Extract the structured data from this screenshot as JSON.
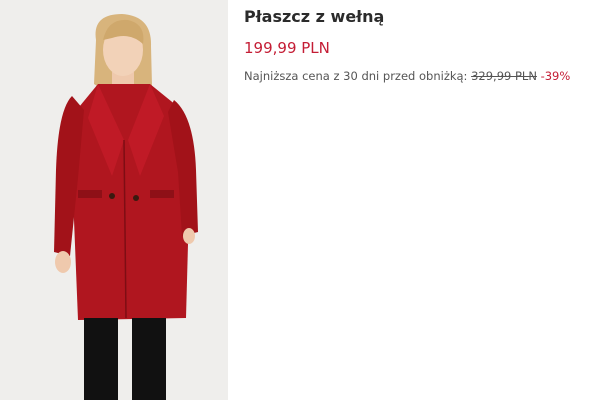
{
  "product": {
    "name": "Płaszcz z wełną",
    "price": "199,99 PLN",
    "lowest_price_label": "Najniższa cena z 30 dni przed obniżką:",
    "old_price": "329,99 PLN",
    "discount": "-39%"
  },
  "image": {
    "subject": "model-in-red-coat",
    "colors": {
      "background": "#efeeec",
      "coat": "#b0161f",
      "trousers": "#111111",
      "price_accent": "#c41d35"
    }
  }
}
